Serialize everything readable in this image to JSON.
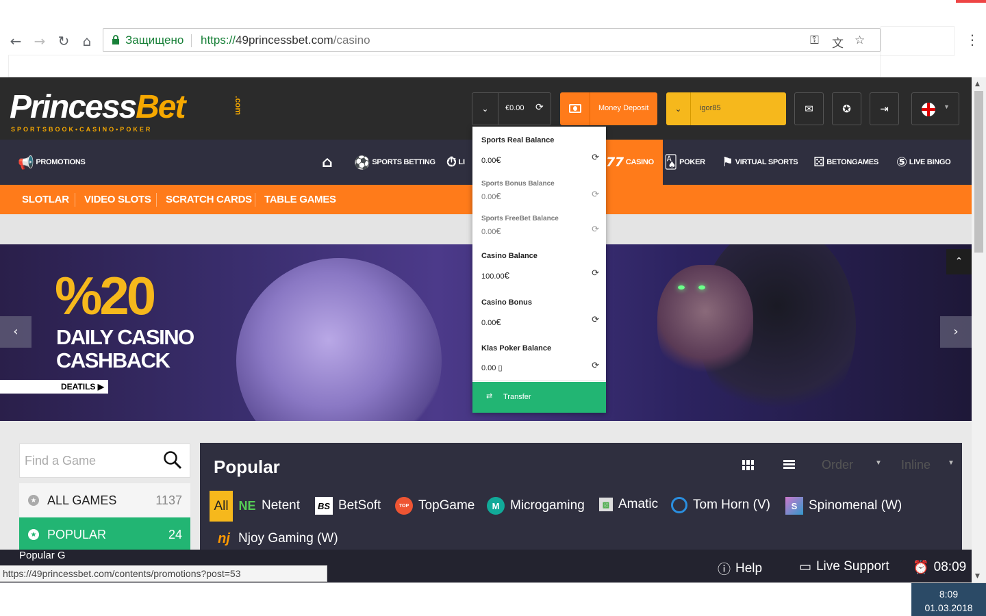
{
  "browser": {
    "secure_label": "Защищено",
    "url_scheme": "https://",
    "url_host": "49princessbet.com",
    "url_path": "/casino",
    "status_url": "https://49princessbet.com/contents/promotions?post=53"
  },
  "header": {
    "logo_princess": "Princess",
    "logo_bet": "Bet",
    "logo_com": ".com",
    "logo_tagline": "SPORTSBOOK•CASINO•POKER",
    "balance": "€0.00",
    "deposit_label": "Money Deposit",
    "username": "igor85"
  },
  "main_nav": {
    "promotions": "PROMOTIONS",
    "sports_betting": "SPORTS BETTING",
    "live_partial": "LI",
    "casino": "CASINO",
    "poker": "POKER",
    "virtual_sports": "VIRTUAL SPORTS",
    "betongames": "BETONGAMES",
    "live_bingo": "LIVE BINGO"
  },
  "sub_nav": [
    "SLOTLAR",
    "VIDEO SLOTS",
    "SCRATCH CARDS",
    "TABLE GAMES"
  ],
  "banner": {
    "percent": "%20",
    "line1": "DAILY CASINO",
    "line2": "CASHBACK",
    "details": "DEATILS"
  },
  "balances": [
    {
      "label": "Sports Real Balance",
      "value": "0.00",
      "currency": "€"
    },
    {
      "label": "Sports Bonus Balance",
      "value": "0.00",
      "currency": "€"
    },
    {
      "label": "Sports FreeBet Balance",
      "value": "0.00",
      "currency": "€"
    },
    {
      "label": "Casino Balance",
      "value": "100.00",
      "currency": "€"
    },
    {
      "label": "Casino Bonus",
      "value": "0.00",
      "currency": "€"
    },
    {
      "label": "Klas Poker Balance",
      "value": "0.00",
      "currency": "▯"
    }
  ],
  "transfer_label": "Transfer",
  "sidebar": {
    "search_placeholder": "Find a Game",
    "categories": [
      {
        "label": "ALL GAMES",
        "count": "1137"
      },
      {
        "label": "POPULAR",
        "count": "24"
      }
    ]
  },
  "games": {
    "title": "Popular",
    "order_label": "Order",
    "inline_label": "Inline",
    "providers_all": "All",
    "providers": [
      "Netent",
      "BetSoft",
      "TopGame",
      "Microgaming",
      "Amatic",
      "Tom Horn (V)",
      "Spinomenal (W)",
      "Njoy Gaming (W)"
    ]
  },
  "footer": {
    "help": "Help",
    "live_support": "Live Support",
    "time": "08:09",
    "partial_tab": "Popular G"
  },
  "taskbar": {
    "time": "8:09",
    "date": "01.03.2018"
  },
  "colors": {
    "brand_orange": "#ff7b1a",
    "brand_yellow": "#f6b81c",
    "green": "#22b573",
    "dark": "#2b2b2b"
  }
}
